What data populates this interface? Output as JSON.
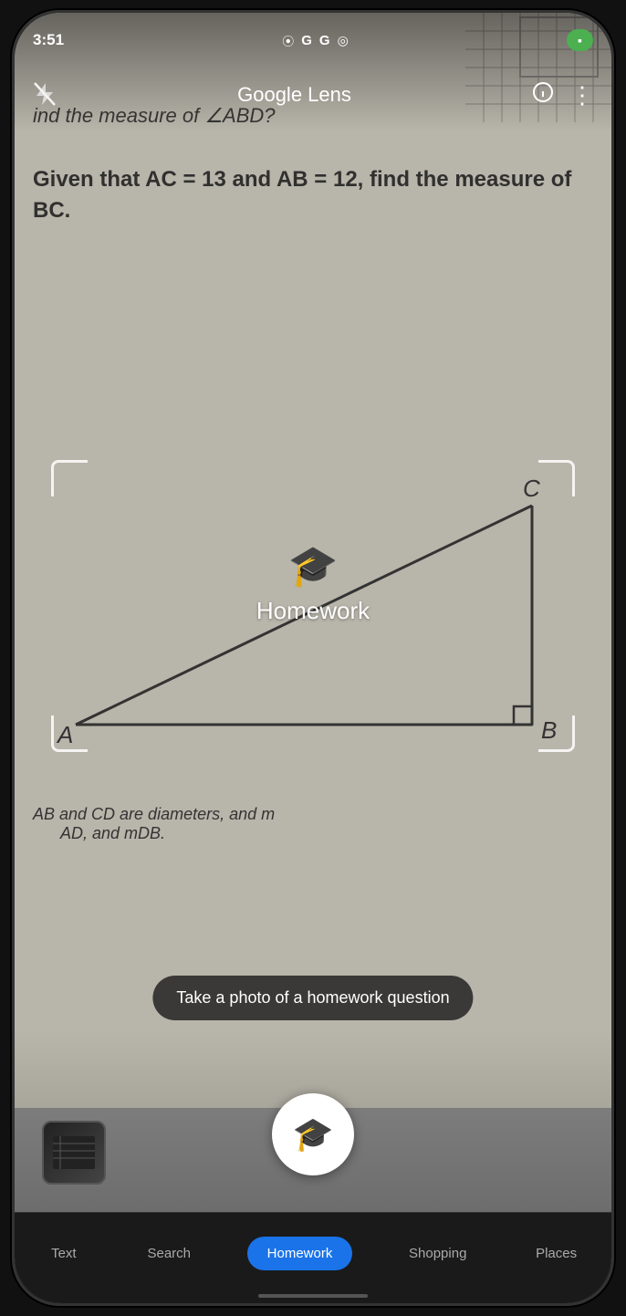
{
  "status": {
    "time": "3:51",
    "battery_icon": "▪",
    "camera_recording": true
  },
  "header": {
    "title": "Google Lens",
    "flash_label": "flash-off",
    "info_label": "info",
    "more_label": "more"
  },
  "camera": {
    "paper_text_1": "ind the measure of ∠ABD?",
    "paper_text_2": "Given that AC = 13 and AB = 12, find the measure of BC.",
    "triangle_label_c": "C",
    "triangle_label_b": "B",
    "triangle_label_a": "A",
    "bottom_paper_line1": "AB and CD are diameters, and m",
    "bottom_paper_line2": "AD, and mDB."
  },
  "mode_label": {
    "icon": "🎓",
    "text": "Homework"
  },
  "tooltip": {
    "text": "Take a photo of a homework question"
  },
  "nav": {
    "items": [
      {
        "label": "Text",
        "active": false
      },
      {
        "label": "Search",
        "active": false
      },
      {
        "label": "Homework",
        "active": true
      },
      {
        "label": "Shopping",
        "active": false
      },
      {
        "label": "Places",
        "active": false
      }
    ]
  },
  "icons": {
    "flash_off": "⚡",
    "info": "ⓘ",
    "more": "⋮",
    "camera": "📷",
    "homework": "🎓"
  }
}
